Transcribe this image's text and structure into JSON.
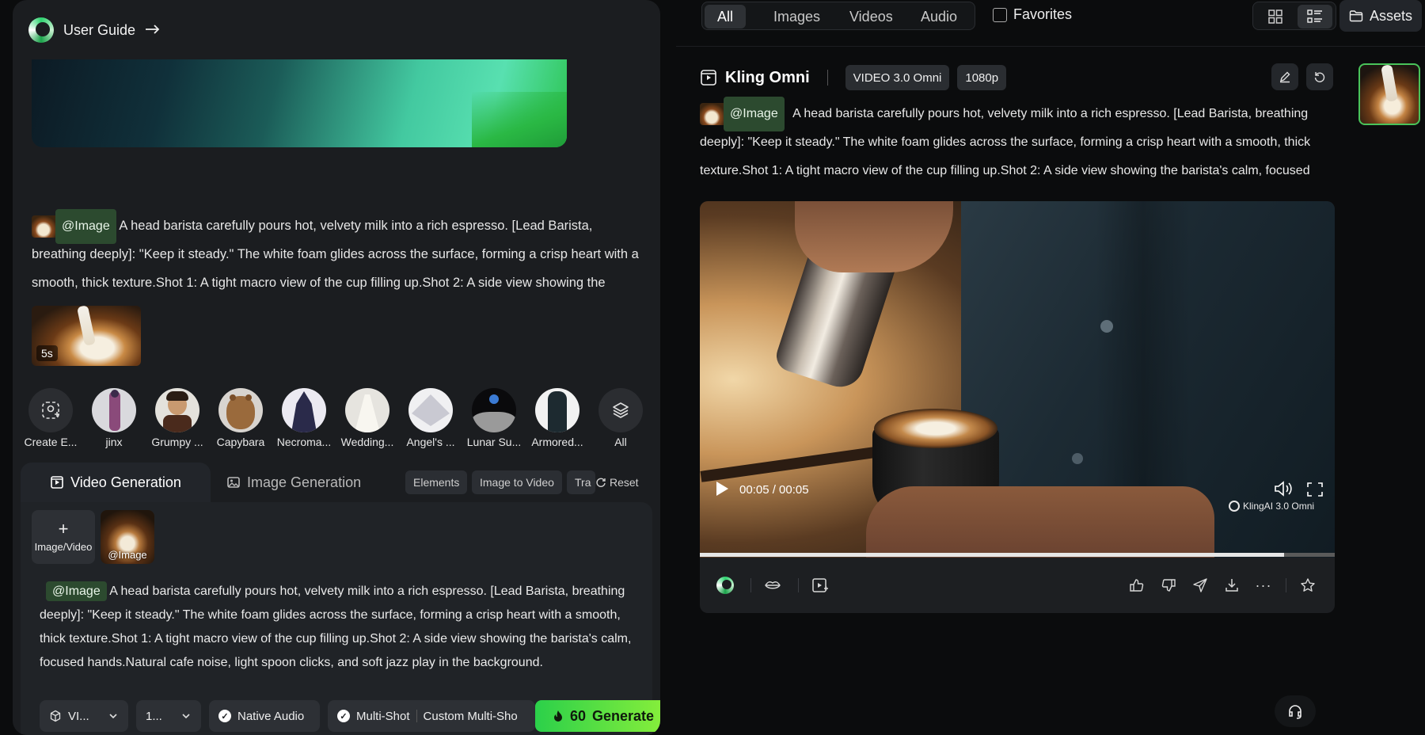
{
  "left": {
    "guide_label": "User Guide",
    "prompt_history": {
      "image_tag": "@Image",
      "text": "A head barista carefully pours hot, velvety milk into a rich espresso. [Lead Barista, breathing deeply]: \"Keep it steady.\" The white foam glides across the surface, forming a crisp heart with a smooth, thick texture.Shot 1: A tight macro view of the cup filling up.Shot 2: A side view showing the",
      "duration": "5s"
    },
    "elements": [
      {
        "name": "Create E...",
        "icon": "create-element-icon"
      },
      {
        "name": "jinx"
      },
      {
        "name": "Grumpy ..."
      },
      {
        "name": "Capybara"
      },
      {
        "name": "Necroma..."
      },
      {
        "name": "Wedding..."
      },
      {
        "name": "Angel's ..."
      },
      {
        "name": "Lunar Su..."
      },
      {
        "name": "Armored..."
      },
      {
        "name": "All",
        "icon": "layers-icon"
      }
    ],
    "tabs": {
      "video": "Video Generation",
      "image": "Image Generation",
      "pills": [
        "Elements",
        "Image to Video",
        "Tra"
      ],
      "reset": "Reset"
    },
    "composer": {
      "add_label": "Image/Video",
      "ref_label": "@Image",
      "image_tag": "@Image",
      "prompt": "A head barista carefully pours hot, velvety milk into a rich espresso. [Lead Barista, breathing deeply]: \"Keep it steady.\" The white foam glides across the surface, forming a crisp heart with a smooth, thick texture.Shot 1: A tight macro view of the cup filling up.Shot 2: A side view showing the barista's calm, focused hands.Natural cafe noise, light spoon clicks, and soft jazz play in the background."
    },
    "bottom_bar": {
      "model": "VI...",
      "resolution": "1...",
      "native_audio": "Native Audio",
      "multi_shot": "Multi-Shot",
      "custom_multi_shot": "Custom Multi-Sho",
      "credits": "60",
      "generate": "Generate"
    }
  },
  "right": {
    "filters": [
      "All",
      "Images",
      "Videos",
      "Audio"
    ],
    "active_filter": "All",
    "favorites": "Favorites",
    "assets": "Assets",
    "generation": {
      "title": "Kling Omni",
      "badges": [
        "VIDEO 3.0 Omni",
        "1080p"
      ],
      "image_tag": "@Image",
      "prompt": "A head barista carefully pours hot, velvety milk into a rich espresso. [Lead Barista, breathing deeply]: \"Keep it steady.\" The white foam glides across the surface, forming a crisp heart with a smooth, thick texture.Shot 1: A tight macro view of the cup filling up.Shot 2: A side view showing the barista's calm, focused"
    },
    "video": {
      "time": "00:05 / 00:05",
      "watermark": "KlingAI 3.0 Omni",
      "progress": 0.92
    }
  },
  "colors": {
    "accent": "#2bd04a",
    "tag_bg": "#2c4a2f",
    "panel": "#1b1d20",
    "background": "#0b0c0d"
  }
}
